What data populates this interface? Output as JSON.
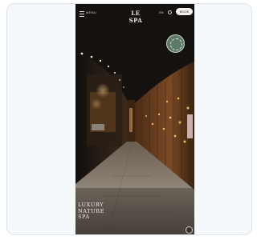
{
  "app": {
    "menu_label": "MENU",
    "brand": "LE SPA",
    "language": "EN",
    "book_label": "BOOK"
  },
  "hero": {
    "headline_lines": [
      "LUXURY",
      "NATURE",
      "SPA"
    ]
  },
  "icons": {
    "menu": "menu-icon",
    "search": "search-icon",
    "badge": "leaf-badge-icon",
    "scroll": "arrow-down-icon"
  },
  "colors": {
    "card_border": "#dce3ec",
    "card_background": "#f6f9fc",
    "badge": "#5d7a66",
    "warm_light": "#e8a65a"
  }
}
